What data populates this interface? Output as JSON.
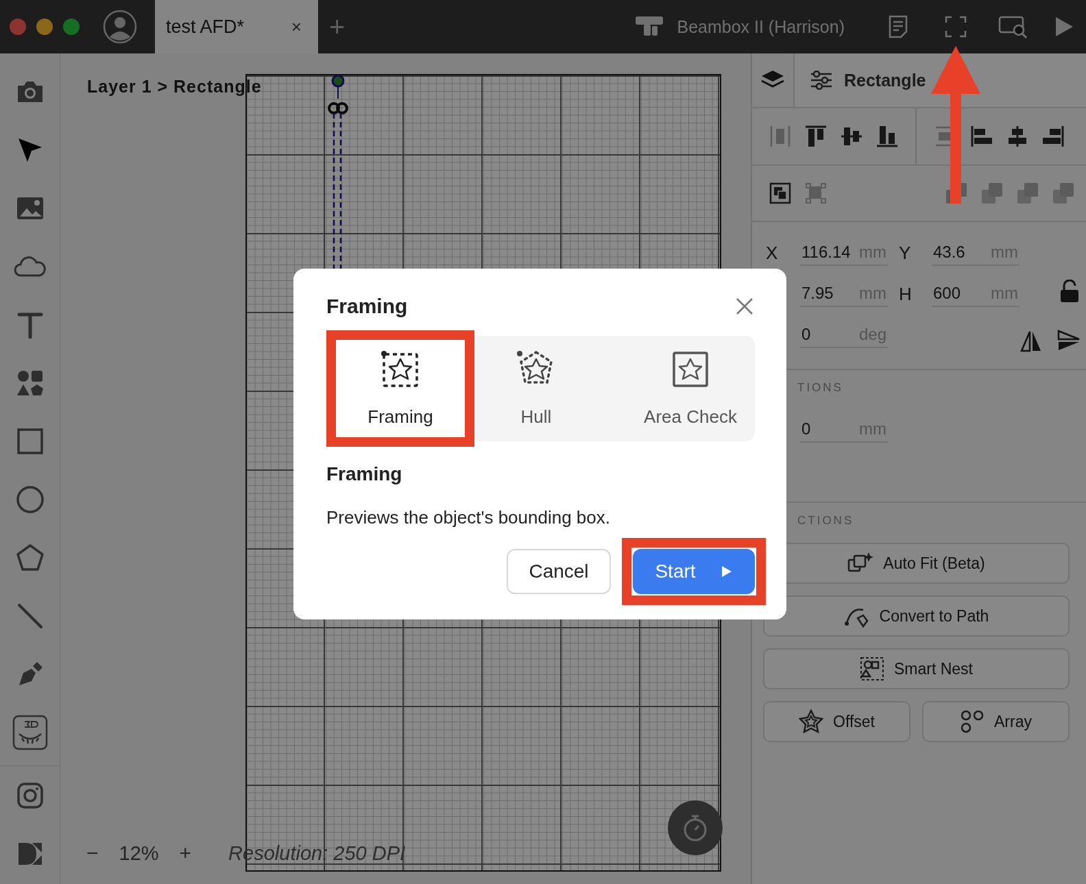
{
  "top_bar": {
    "tab": {
      "title": "test AFD*",
      "close": "×"
    },
    "new_tab": "+",
    "machine": "Beambox II (Harrison)",
    "actions": [
      {
        "kind": "doc",
        "highlighted": false
      },
      {
        "kind": "frame",
        "highlighted": true
      },
      {
        "kind": "preview",
        "highlighted": false
      },
      {
        "kind": "run",
        "highlighted": false
      }
    ]
  },
  "toolbar": {
    "tools": [
      {
        "kind": "camera",
        "selected": false
      },
      {
        "kind": "select",
        "selected": true
      },
      {
        "kind": "image",
        "selected": false
      },
      {
        "kind": "cloud",
        "selected": false
      },
      {
        "kind": "text",
        "selected": false
      },
      {
        "kind": "shapes",
        "selected": false
      },
      {
        "kind": "rect",
        "selected": false
      },
      {
        "kind": "ellipse",
        "selected": false
      },
      {
        "kind": "polygon",
        "selected": false
      },
      {
        "kind": "line",
        "selected": false
      },
      {
        "kind": "pen",
        "selected": false
      },
      {
        "kind": "curve",
        "selected": false
      }
    ],
    "bottom_tools": [
      {
        "kind": "instagram"
      },
      {
        "kind": "ds"
      }
    ]
  },
  "canvas": {
    "breadcrumb": "Layer 1 > Rectangle",
    "zoom_out": "−",
    "zoom": "12%",
    "zoom_in": "+",
    "resolution": "Resolution: 250 DPI"
  },
  "panel": {
    "tabs": [
      {
        "kind": "layers",
        "selected": false
      },
      {
        "kind": "object",
        "label": "Rectangle",
        "selected": true
      }
    ],
    "align_tools": [
      {
        "kind": "dist-h",
        "disabled": true
      },
      {
        "kind": "top",
        "disabled": false
      },
      {
        "kind": "middle",
        "disabled": false
      },
      {
        "kind": "bottom",
        "disabled": false
      },
      {
        "kind": "dist-v",
        "disabled": true
      },
      {
        "kind": "left",
        "disabled": false
      },
      {
        "kind": "center",
        "disabled": false
      },
      {
        "kind": "right",
        "disabled": false
      }
    ],
    "group_tools": [
      {
        "kind": "group",
        "disabled": false
      },
      {
        "kind": "ungroup",
        "disabled": true
      }
    ],
    "bool_tools": [
      {
        "kind": "union",
        "disabled": true
      },
      {
        "kind": "subtract",
        "disabled": true
      },
      {
        "kind": "intersect",
        "disabled": true
      },
      {
        "kind": "diff",
        "disabled": true
      }
    ],
    "fields": [
      {
        "label": "X",
        "value": "116.14",
        "unit": "mm"
      },
      {
        "label": "Y",
        "value": "43.6",
        "unit": "mm"
      },
      {
        "value": "7.95",
        "unit": "mm"
      },
      {
        "label": "H",
        "value": "600",
        "unit": "mm"
      },
      {
        "value": "0",
        "unit": "deg"
      }
    ],
    "locked": false,
    "options_header": "TIONS",
    "corner_field": {
      "value": "0",
      "unit": "mm"
    },
    "actions_header": "CTIONS",
    "actions": [
      {
        "kind": "autofit",
        "label": "Auto Fit (Beta)",
        "half": false
      },
      {
        "kind": "path",
        "label": "Convert to Path",
        "half": false
      },
      {
        "kind": "nest",
        "label": "Smart Nest",
        "half": false
      },
      {
        "kind": "offset",
        "label": "Offset",
        "half": true
      },
      {
        "kind": "array",
        "label": "Array",
        "half": true
      }
    ]
  },
  "dialog": {
    "title": "Framing",
    "modes": [
      {
        "kind": "framing",
        "label": "Framing",
        "selected": true,
        "highlighted": true
      },
      {
        "kind": "hull",
        "label": "Hull",
        "selected": false,
        "highlighted": false
      },
      {
        "kind": "area",
        "label": "Area Check",
        "selected": false,
        "highlighted": false
      }
    ],
    "subtitle": "Framing",
    "description": "Previews the object's bounding box.",
    "buttons": [
      {
        "kind": "cancel",
        "label": "Cancel",
        "highlighted": false
      },
      {
        "kind": "start",
        "label": "Start",
        "highlighted": true
      }
    ]
  }
}
